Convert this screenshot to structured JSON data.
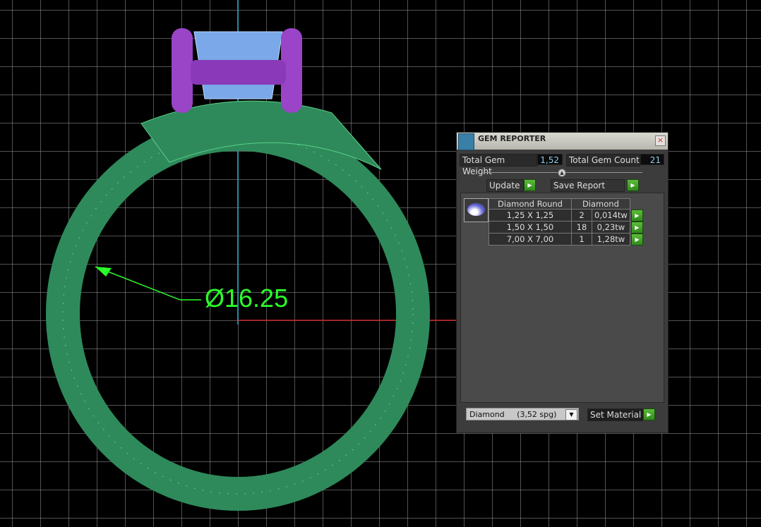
{
  "viewport": {
    "dimension_label": "Ø16.25",
    "colors": {
      "ring": "#2e8a5a",
      "prongs": "#9a44c8",
      "gem": "#7aa8e8",
      "dimension": "#2bff2b"
    }
  },
  "panel": {
    "title": "GEM REPORTER",
    "close_icon": "×",
    "total_weight_label": "Total Gem Weight",
    "total_weight_value": "1,52",
    "total_count_label": "Total Gem Count",
    "total_count_value": "21",
    "update_label": "Update",
    "save_report_label": "Save Report",
    "table": {
      "headers": [
        "Diamond Round",
        "Diamond"
      ],
      "rows": [
        {
          "size": "1,25 X 1,25",
          "count": "2",
          "weight": "0,014tw"
        },
        {
          "size": "1,50 X 1,50",
          "count": "18",
          "weight": "0,23tw"
        },
        {
          "size": "7,00 X 7,00",
          "count": "1",
          "weight": "1,28tw"
        }
      ]
    },
    "material_select": "Diamond     (3,52 spg)",
    "set_material_label": "Set Material"
  }
}
